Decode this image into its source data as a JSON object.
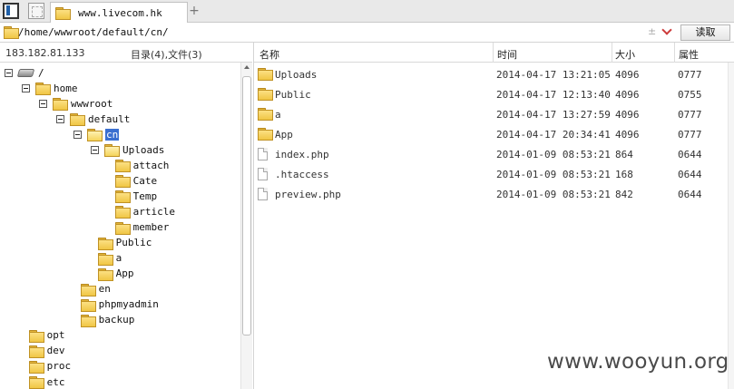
{
  "tabbar": {
    "tab_title": "www.livecom.hk",
    "add_tab_label": "+"
  },
  "address": {
    "path": "/home/wwwroot/default/cn/",
    "plusminus": "±",
    "read_label": "读取"
  },
  "left_header": {
    "ip": "183.182.81.133",
    "counts": "目录(4),文件(3)"
  },
  "tree": [
    {
      "label": "/",
      "type": "drive"
    },
    {
      "label": "home",
      "type": "folder"
    },
    {
      "label": "wwwroot",
      "type": "folder"
    },
    {
      "label": "default",
      "type": "folder"
    },
    {
      "label": "cn",
      "type": "folder",
      "selected": true
    },
    {
      "label": "Uploads",
      "type": "folder"
    },
    {
      "label": "attach",
      "type": "folder"
    },
    {
      "label": "Cate",
      "type": "folder"
    },
    {
      "label": "Temp",
      "type": "folder"
    },
    {
      "label": "article",
      "type": "folder"
    },
    {
      "label": "member",
      "type": "folder"
    },
    {
      "label": "Public",
      "type": "folder"
    },
    {
      "label": "a",
      "type": "folder"
    },
    {
      "label": "App",
      "type": "folder"
    },
    {
      "label": "en",
      "type": "folder"
    },
    {
      "label": "phpmyadmin",
      "type": "folder"
    },
    {
      "label": "backup",
      "type": "folder"
    },
    {
      "label": "opt",
      "type": "folder"
    },
    {
      "label": "dev",
      "type": "folder"
    },
    {
      "label": "proc",
      "type": "folder"
    },
    {
      "label": "etc",
      "type": "folder"
    }
  ],
  "columns": {
    "name": "名称",
    "time": "时间",
    "size": "大小",
    "perm": "属性"
  },
  "files": [
    {
      "name": "Uploads",
      "time": "2014-04-17 13:21:05",
      "size": "4096",
      "perm": "0777",
      "type": "folder"
    },
    {
      "name": "Public",
      "time": "2014-04-17 12:13:40",
      "size": "4096",
      "perm": "0755",
      "type": "folder"
    },
    {
      "name": "a",
      "time": "2014-04-17 13:27:59",
      "size": "4096",
      "perm": "0777",
      "type": "folder"
    },
    {
      "name": "App",
      "time": "2014-04-17 20:34:41",
      "size": "4096",
      "perm": "0777",
      "type": "folder"
    },
    {
      "name": "index.php",
      "time": "2014-01-09 08:53:21",
      "size": "864",
      "perm": "0644",
      "type": "file"
    },
    {
      "name": ".htaccess",
      "time": "2014-01-09 08:53:21",
      "size": "168",
      "perm": "0644",
      "type": "file"
    },
    {
      "name": "preview.php",
      "time": "2014-01-09 08:53:21",
      "size": "842",
      "perm": "0644",
      "type": "file"
    }
  ],
  "watermark": "www.wooyun.org",
  "colors": {
    "selection": "#3a6fd0",
    "folder": "#f0c645",
    "dropdown_chevron": "#cc3b3b"
  }
}
